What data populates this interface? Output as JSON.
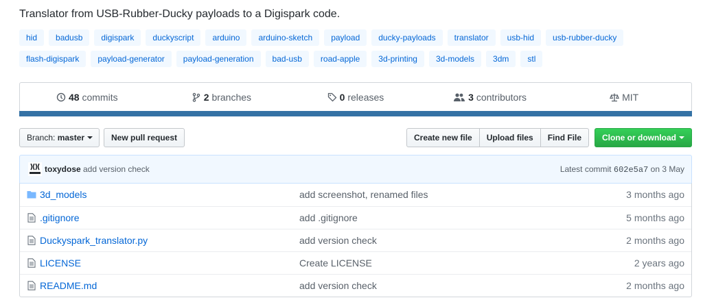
{
  "repo": {
    "description": "Translator from USB-Rubber-Ducky payloads to a Digispark code."
  },
  "topics": {
    "row1": [
      "hid",
      "badusb",
      "digispark",
      "duckyscript",
      "arduino",
      "arduino-sketch",
      "payload",
      "ducky-payloads",
      "translator",
      "usb-hid",
      "usb-rubber-ducky"
    ],
    "row2": [
      "flash-digispark",
      "payload-generator",
      "payload-generation",
      "bad-usb",
      "road-apple",
      "3d-printing",
      "3d-models",
      "3dm",
      "stl"
    ]
  },
  "summary": {
    "commits_count": "48",
    "commits_label": "commits",
    "branches_count": "2",
    "branches_label": "branches",
    "releases_count": "0",
    "releases_label": "releases",
    "contributors_count": "3",
    "contributors_label": "contributors",
    "license": "MIT",
    "language_color": "#3572A5"
  },
  "toolbar": {
    "branch_prefix": "Branch:",
    "branch_name": "master",
    "new_pr": "New pull request",
    "create_file": "Create new file",
    "upload_files": "Upload files",
    "find_file": "Find File",
    "clone": "Clone or download"
  },
  "commit": {
    "author": "toxydose",
    "message": "add version check",
    "latest_label": "Latest commit",
    "sha": "602e5a7",
    "date": "on 3 May"
  },
  "files": [
    {
      "name": "3d_models",
      "type": "folder",
      "message": "add screenshot, renamed files",
      "age": "3 months ago"
    },
    {
      "name": ".gitignore",
      "type": "file",
      "message": "add .gitignore",
      "age": "5 months ago"
    },
    {
      "name": "Duckyspark_translator.py",
      "type": "file",
      "message": "add version check",
      "age": "2 months ago"
    },
    {
      "name": "LICENSE",
      "type": "file",
      "message": "Create LICENSE",
      "age": "2 years ago"
    },
    {
      "name": "README.md",
      "type": "file",
      "message": "add version check",
      "age": "2 months ago"
    }
  ]
}
